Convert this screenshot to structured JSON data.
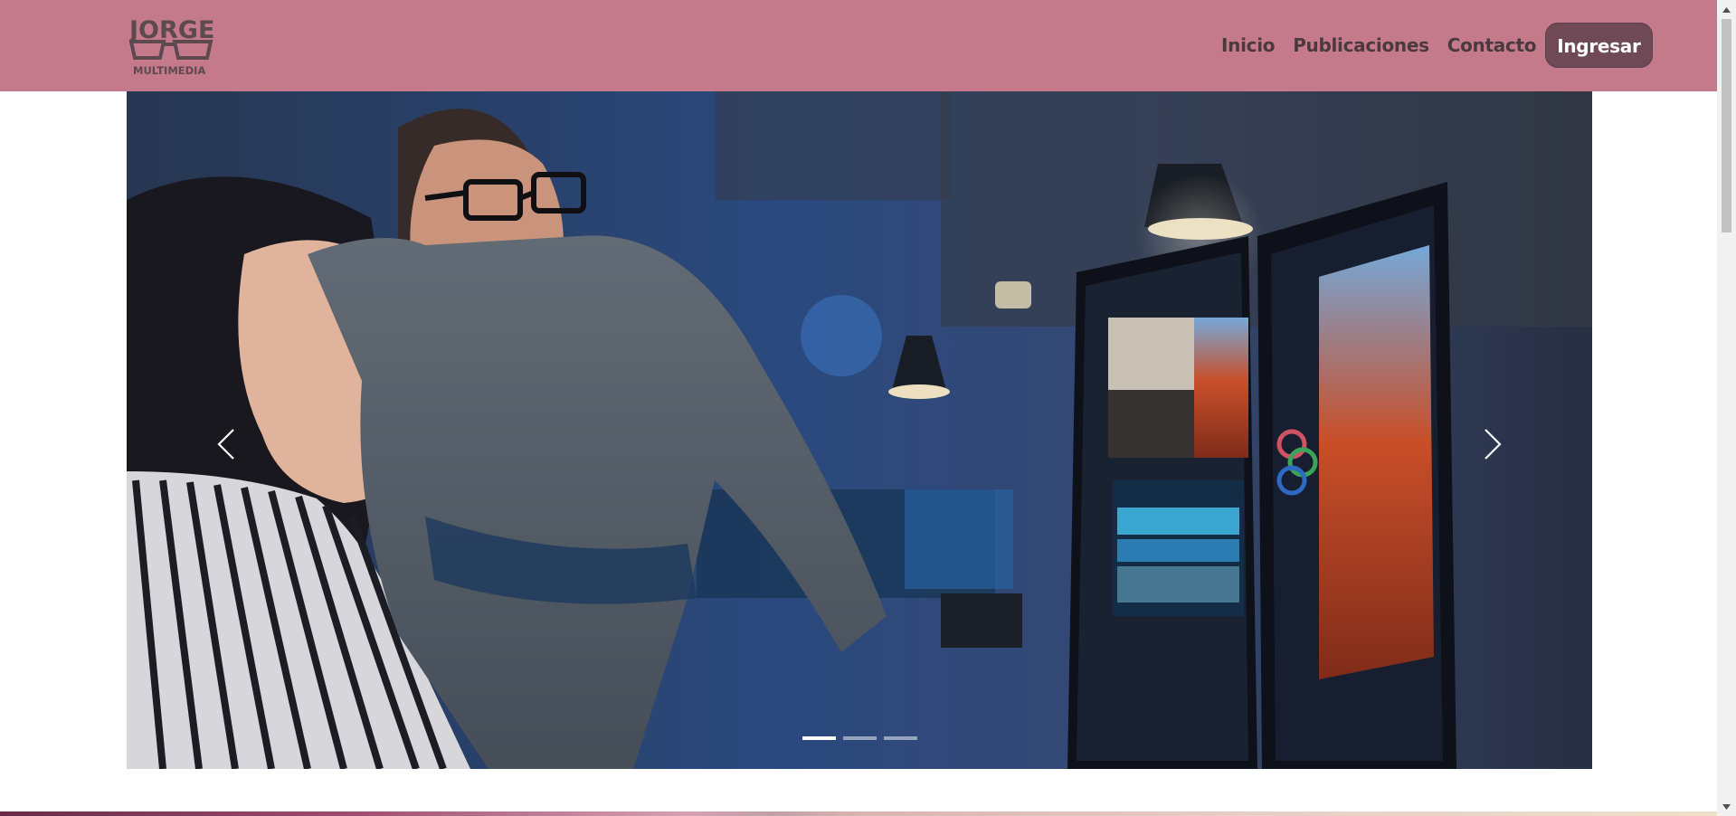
{
  "brand": {
    "logo_top": "JORGE",
    "logo_bottom": "MULTIMEDIA"
  },
  "nav": {
    "items": [
      {
        "label": "Inicio"
      },
      {
        "label": "Publicaciones"
      },
      {
        "label": "Contacto"
      }
    ],
    "cta_label": "Ingresar"
  },
  "carousel": {
    "prev_icon": "chevron-left-icon",
    "next_icon": "chevron-right-icon",
    "slide_count": 3,
    "active_slide": 1
  },
  "colors": {
    "header_bg": "#c57a8c",
    "cta_bg": "#6f4a56",
    "nav_text": "#4a3a40"
  }
}
